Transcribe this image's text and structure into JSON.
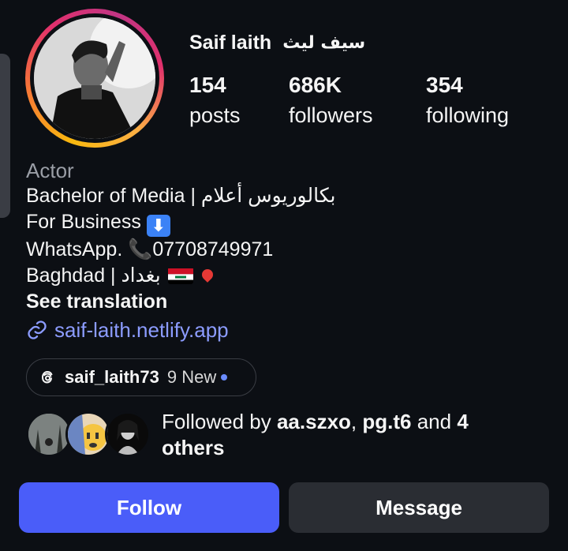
{
  "profile": {
    "name": "Saif laith",
    "name_ar": "سيف ليث",
    "stats": [
      {
        "value": "154",
        "label": "posts"
      },
      {
        "value": "686K",
        "label": "followers"
      },
      {
        "value": "354",
        "label": "following"
      }
    ]
  },
  "bio": {
    "category": "Actor",
    "line1": "Bachelor of Media | بكالوريوس أعلام",
    "line2": "For Business",
    "line2_icon": "down-arrow-emoji",
    "line3": "WhatsApp. 📞07708749971",
    "line4_a": "Baghdad | بغداد",
    "line4_flag": "iraq-flag-emoji",
    "line4_pin": "pin-emoji",
    "see_translation": "See translation",
    "link": "saif-laith.netlify.app"
  },
  "threads": {
    "handle": "saif_laith73",
    "new_label": "9 New"
  },
  "followed_by": {
    "prefix": "Followed by ",
    "user1": "aa.szxo",
    "separator": ", ",
    "user2": "pg.t6",
    "and": " and ",
    "others": "4 others"
  },
  "actions": {
    "follow": "Follow",
    "message": "Message"
  },
  "colors": {
    "background": "#0c0f14",
    "follow_button": "#4a5df9",
    "message_button": "#2a2d33",
    "link": "#8c9cff"
  }
}
